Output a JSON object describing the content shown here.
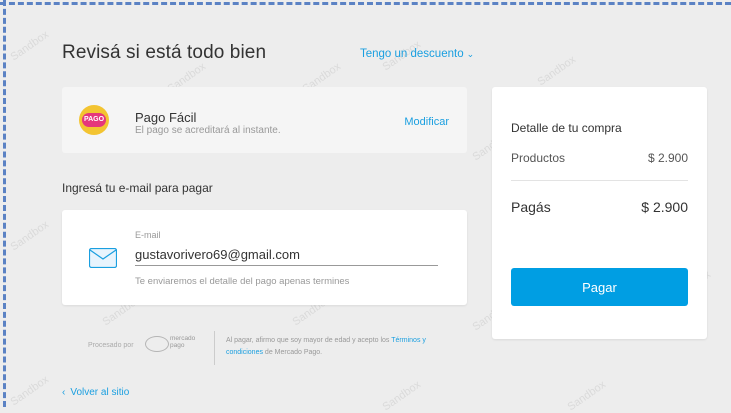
{
  "header": {
    "title": "Revisá si está todo bien",
    "discount_link": "Tengo un descuento"
  },
  "payment_method": {
    "logo_text": "PAGO",
    "name": "Pago Fácil",
    "description": "El pago se acreditará al instante.",
    "modify_label": "Modificar"
  },
  "email_section": {
    "heading": "Ingresá tu e-mail para pagar",
    "label": "E-mail",
    "value": "gustavorivero69@gmail.com",
    "hint": "Te enviaremos el detalle del pago apenas termines"
  },
  "footer": {
    "processed_by": "Procesado por",
    "logo_line1": "mercado",
    "logo_line2": "pago",
    "legal_before": "Al pagar, afirmo que soy mayor de edad y acepto los",
    "legal_link": "Términos y condiciones",
    "legal_after": "de Mercado Pago.",
    "back_link": "Volver al sitio"
  },
  "summary": {
    "title": "Detalle de tu compra",
    "products_label": "Productos",
    "products_value": "$ 2.900",
    "total_label": "Pagás",
    "total_value": "$ 2.900",
    "pay_button": "Pagar"
  },
  "colors": {
    "accent": "#009ee3",
    "link": "#1a9fe0",
    "background": "#ededed",
    "frame_dash": "#5b82c4"
  },
  "icons": {
    "discount_chevron": "chevron-down-icon",
    "email": "envelope-icon",
    "back": "chevron-left-icon"
  }
}
